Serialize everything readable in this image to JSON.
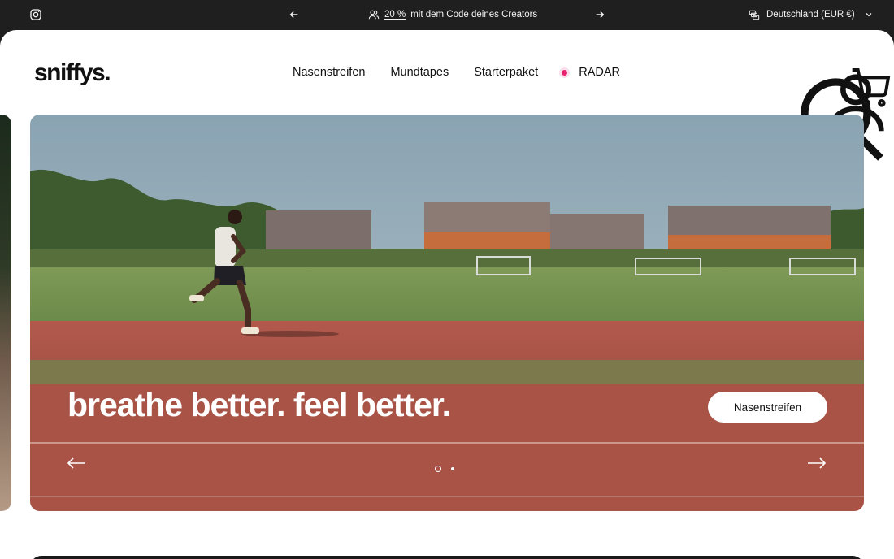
{
  "announcement": {
    "promo_code": "20 %",
    "promo_text": "mit dem Code deines Creators",
    "country_selector": "Deutschland (EUR €)"
  },
  "header": {
    "logo": "sniffys.",
    "nav": [
      {
        "label": "Nasenstreifen"
      },
      {
        "label": "Mundtapes"
      },
      {
        "label": "Starterpaket"
      },
      {
        "label": "RADAR"
      }
    ],
    "icons": [
      "search-icon",
      "account-icon",
      "cart-icon"
    ],
    "radar_dot_color": "#e8226f"
  },
  "hero": {
    "headline": "breathe better. feel better.",
    "cta_label": "Nasenstreifen",
    "slides_total": 2,
    "active_slide": 1
  }
}
